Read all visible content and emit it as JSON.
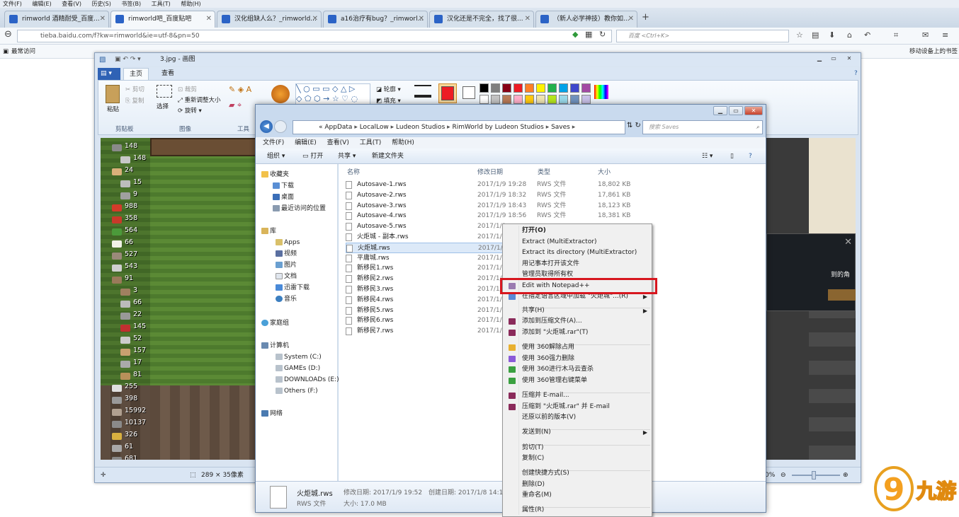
{
  "browser": {
    "menubar": [
      "文件(F)",
      "编辑(E)",
      "查看(V)",
      "历史(S)",
      "书签(B)",
      "工具(T)",
      "帮助(H)"
    ],
    "tabs": [
      {
        "title": "rimworld 酒精耐受_百度..."
      },
      {
        "title": "rimworld吧_百度贴吧"
      },
      {
        "title": "汉化组缺人么？_rimworld..."
      },
      {
        "title": "a16治疗有bug？_rimworl..."
      },
      {
        "title": "汉化还是不完全，找了很..."
      },
      {
        "title": "（新人必学神技）教你如..."
      }
    ],
    "url": "tieba.baidu.com/f?kw=rimworld&ie=utf-8&pn=50",
    "search_placeholder": "百度 <Ctrl+K>",
    "bookmark_left": "最常访问",
    "bookmark_right": "移动设备上的书签"
  },
  "paint": {
    "title": "3.jpg - 画图",
    "tabs": [
      "主页",
      "查看"
    ],
    "clipboard": {
      "paste": "粘贴",
      "cut": "剪切",
      "copy": "复制",
      "label": "剪贴板"
    },
    "image": {
      "select": "选择",
      "crop": "裁剪",
      "resize": "重新调整大小",
      "rotate": "旋转",
      "label": "图像"
    },
    "tools_label": "工具",
    "outline": "轮廓",
    "fill": "填充",
    "status_size": "289 × 35像素",
    "zoom_pct": "0%",
    "colors": [
      "#000000",
      "#7f7f7f",
      "#880015",
      "#ed1c24",
      "#ff7f27",
      "#fff200",
      "#22b14c",
      "#00a2e8",
      "#3f48cc",
      "#a349a4",
      "#ffffff",
      "#c3c3c3",
      "#b97a57",
      "#ffaec9",
      "#ffc90e",
      "#efe4b0",
      "#b5e61d",
      "#99d9ea",
      "#7092be",
      "#c8bfe7"
    ],
    "color1": "#ed1c24"
  },
  "game": {
    "resources": [
      "148",
      "148",
      "24",
      "15",
      "9",
      "988",
      "358",
      "564",
      "66",
      "527",
      "543",
      "91",
      "3",
      "66",
      "22",
      "145",
      "52",
      "157",
      "17",
      "81",
      "255",
      "398",
      "15992",
      "10137",
      "326",
      "61",
      "681"
    ],
    "popup_text": "到的角"
  },
  "explorer": {
    "path": [
      "AppData",
      "LocalLow",
      "Ludeon Studios",
      "RimWorld by Ludeon Studios",
      "Saves"
    ],
    "search_placeholder": "搜索 Saves",
    "menu": [
      "文件(F)",
      "编辑(E)",
      "查看(V)",
      "工具(T)",
      "帮助(H)"
    ],
    "toolbar": {
      "organize": "组织 ▾",
      "open": "打开",
      "share": "共享 ▾",
      "newfolder": "新建文件夹"
    },
    "nav": {
      "favorites": "收藏夹",
      "fav_items": [
        "下载",
        "桌面",
        "最近访问的位置"
      ],
      "library": "库",
      "lib_items": [
        "Apps",
        "视频",
        "图片",
        "文档",
        "迅雷下载",
        "音乐"
      ],
      "homegroup": "家庭组",
      "computer": "计算机",
      "drives": [
        "System (C:)",
        "GAMEs (D:)",
        "DOWNLOADs (E:)",
        "Others (F:)"
      ],
      "network": "网络"
    },
    "columns": [
      "名称",
      "修改日期",
      "类型",
      "大小"
    ],
    "files": [
      {
        "name": "Autosave-1.rws",
        "date": "2017/1/9 19:28",
        "type": "RWS 文件",
        "size": "18,802 KB"
      },
      {
        "name": "Autosave-2.rws",
        "date": "2017/1/9 18:32",
        "type": "RWS 文件",
        "size": "17,861 KB"
      },
      {
        "name": "Autosave-3.rws",
        "date": "2017/1/9 18:43",
        "type": "RWS 文件",
        "size": "18,123 KB"
      },
      {
        "name": "Autosave-4.rws",
        "date": "2017/1/9 18:56",
        "type": "RWS 文件",
        "size": "18,381 KB"
      },
      {
        "name": "Autosave-5.rws",
        "date": "2017/1/9",
        "type": "",
        "size": ""
      },
      {
        "name": "火炬城 - 副本.rws",
        "date": "2017/1/9",
        "type": "",
        "size": ""
      },
      {
        "name": "火炬城.rws",
        "date": "2017/1/9",
        "type": "",
        "size": ""
      },
      {
        "name": "平庸城.rws",
        "date": "2017/1/8",
        "type": "",
        "size": ""
      },
      {
        "name": "新移民1.rws",
        "date": "2017/1/6",
        "type": "",
        "size": ""
      },
      {
        "name": "新移民2.rws",
        "date": "2017/1/6",
        "type": "",
        "size": ""
      },
      {
        "name": "新移民3.rws",
        "date": "2017/1/6",
        "type": "",
        "size": ""
      },
      {
        "name": "新移民4.rws",
        "date": "2017/1/7",
        "type": "",
        "size": ""
      },
      {
        "name": "新移民5.rws",
        "date": "2017/1/7",
        "type": "",
        "size": ""
      },
      {
        "name": "新移民6.rws",
        "date": "2017/1/7",
        "type": "",
        "size": ""
      },
      {
        "name": "新移民7.rws",
        "date": "2017/1/7",
        "type": "",
        "size": ""
      }
    ],
    "details": {
      "name": "火炬城.rws",
      "type": "RWS 文件",
      "modified": "修改日期: 2017/1/9 19:52",
      "created": "创建日期: 2017/1/8 14:16",
      "size": "大小: 17.0 MB"
    }
  },
  "context_menu": {
    "items": [
      {
        "label": "打开(O)",
        "bold": true
      },
      {
        "label": "Extract (MultiExtractor)"
      },
      {
        "label": "Extract its directory (MultiExtractor)"
      },
      {
        "label": "用记事本打开该文件"
      },
      {
        "label": "管理员取得所有权"
      },
      {
        "label": "Edit with Notepad++"
      },
      {
        "label": "在指定语言区域中加载 \"火炬城\"...(R)"
      },
      {
        "label": "共享(H)"
      },
      {
        "label": "添加到压缩文件(A)..."
      },
      {
        "label": "添加到 \"火炬城.rar\"(T)"
      },
      {
        "label": "使用 360解除占用"
      },
      {
        "label": "使用 360强力删除"
      },
      {
        "label": "使用 360进行木马云查杀"
      },
      {
        "label": "使用 360管理右键菜单"
      },
      {
        "label": "压缩并 E-mail..."
      },
      {
        "label": "压缩到 \"火炬城.rar\" 并 E-mail"
      },
      {
        "label": "还原以前的版本(V)"
      },
      {
        "label": "发送到(N)"
      },
      {
        "label": "剪切(T)"
      },
      {
        "label": "复制(C)"
      },
      {
        "label": "创建快捷方式(S)"
      },
      {
        "label": "删除(D)"
      },
      {
        "label": "重命名(M)"
      },
      {
        "label": "属性(R)"
      }
    ]
  },
  "watermark": {
    "text": "九游"
  }
}
